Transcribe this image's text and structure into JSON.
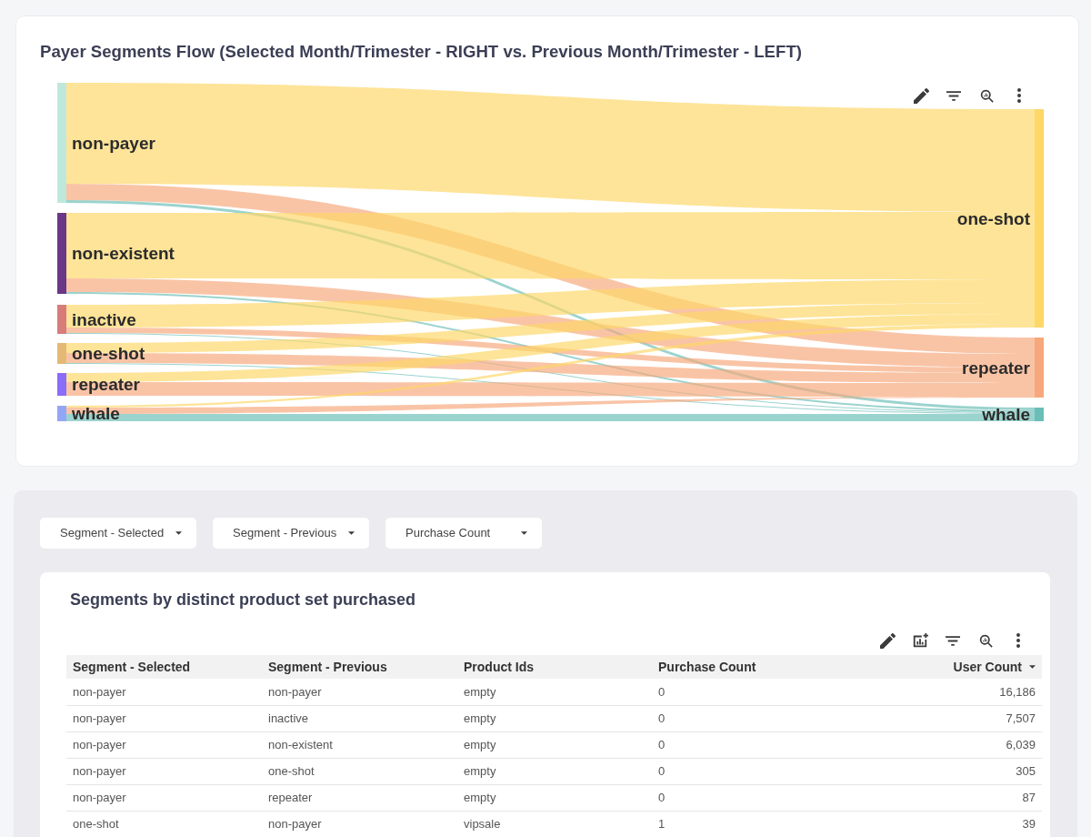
{
  "chart_card": {
    "title": "Payer Segments Flow (Selected Month/Trimester - RIGHT vs. Previous Month/Trimester - LEFT)"
  },
  "sankey": {
    "left_nodes": [
      {
        "label": "non-payer",
        "color": "#bfe8dc"
      },
      {
        "label": "non-existent",
        "color": "#6b3787"
      },
      {
        "label": "inactive",
        "color": "#d87c7a"
      },
      {
        "label": "one-shot",
        "color": "#e4b975"
      },
      {
        "label": "repeater",
        "color": "#8a6df8"
      },
      {
        "label": "whale",
        "color": "#93a6f6"
      }
    ],
    "right_nodes": [
      {
        "label": "one-shot",
        "color": "#fdd767"
      },
      {
        "label": "repeater",
        "color": "#f6a87c"
      },
      {
        "label": "whale",
        "color": "#6bbeb7"
      }
    ]
  },
  "filters": [
    {
      "label": "Segment - Selected"
    },
    {
      "label": "Segment - Previous"
    },
    {
      "label": "Purchase Count"
    }
  ],
  "table_card": {
    "title": "Segments by distinct product set purchased",
    "columns": [
      {
        "label": "Segment - Selected",
        "sorted": false
      },
      {
        "label": "Segment - Previous",
        "sorted": false
      },
      {
        "label": "Product Ids",
        "sorted": false
      },
      {
        "label": "Purchase Count",
        "sorted": false
      },
      {
        "label": "User Count",
        "sorted": true
      }
    ],
    "rows": [
      [
        "non-payer",
        "non-payer",
        "empty",
        "0",
        "16,186"
      ],
      [
        "non-payer",
        "inactive",
        "empty",
        "0",
        "7,507"
      ],
      [
        "non-payer",
        "non-existent",
        "empty",
        "0",
        "6,039"
      ],
      [
        "non-payer",
        "one-shot",
        "empty",
        "0",
        "305"
      ],
      [
        "non-payer",
        "repeater",
        "empty",
        "0",
        "87"
      ],
      [
        "one-shot",
        "non-payer",
        "vipsale",
        "1",
        "39"
      ]
    ]
  }
}
